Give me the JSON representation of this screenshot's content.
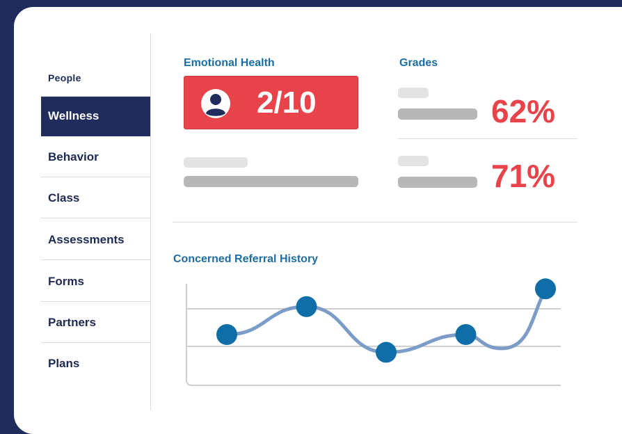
{
  "sidebar": {
    "heading": "People",
    "items": [
      {
        "label": "Wellness",
        "active": true
      },
      {
        "label": "Behavior",
        "active": false
      },
      {
        "label": "Class",
        "active": false
      },
      {
        "label": "Assessments",
        "active": false
      },
      {
        "label": "Forms",
        "active": false
      },
      {
        "label": "Partners",
        "active": false
      },
      {
        "label": "Plans",
        "active": false
      }
    ]
  },
  "emotional_health": {
    "title": "Emotional Health",
    "score": "2/10",
    "icon": "user-avatar-icon"
  },
  "grades": {
    "title": "Grades",
    "values": [
      "62%",
      "71%"
    ]
  },
  "referral_history": {
    "title": "Concerned Referral History"
  },
  "colors": {
    "navy": "#1f2c5c",
    "accent_blue": "#1b6da6",
    "alert_red": "#e8434b",
    "line": "#7a9cc6",
    "point": "#0f6ea8"
  },
  "chart_data": {
    "type": "line",
    "title": "Concerned Referral History",
    "xlabel": "",
    "ylabel": "",
    "grid": true,
    "series": [
      {
        "values": [
          2,
          3.1,
          1.3,
          2,
          3.8
        ]
      }
    ],
    "ylim": [
      0,
      4
    ]
  }
}
